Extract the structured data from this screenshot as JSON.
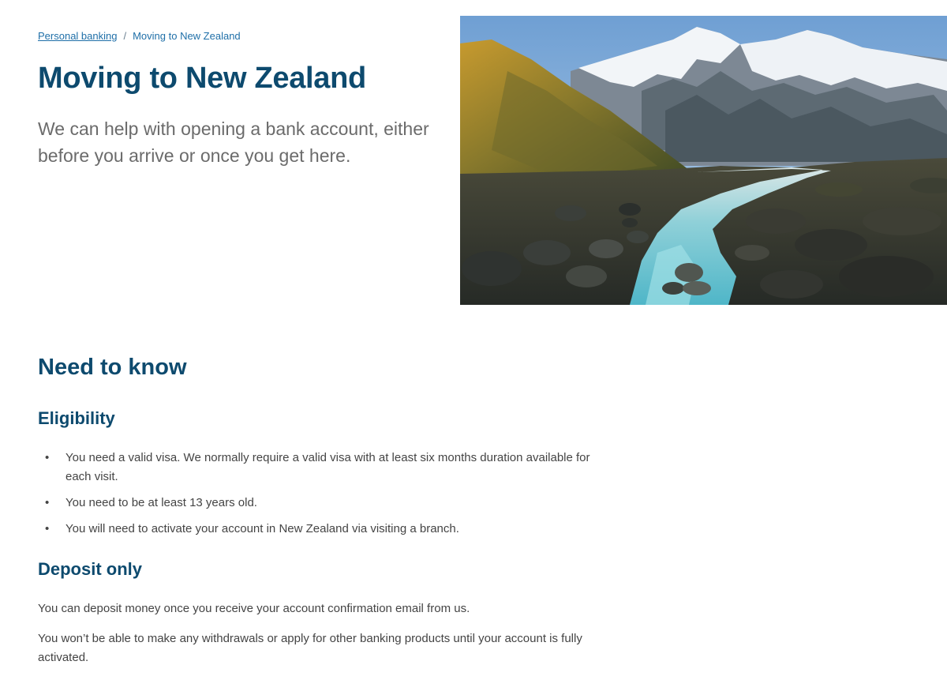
{
  "breadcrumb": {
    "parent": "Personal banking",
    "separator": "/",
    "current": "Moving to New Zealand"
  },
  "hero": {
    "title": "Moving to New Zealand",
    "lead": "We can help with opening a bank account, either before you arrive or once you get here."
  },
  "need_to_know": {
    "title": "Need to know",
    "eligibility": {
      "title": "Eligibility",
      "items": [
        "You need a valid visa. We normally require a valid visa with at least six months duration available for each visit.",
        "You need to be at least 13 years old.",
        "You will need to activate your account in New Zealand via visiting a branch."
      ]
    },
    "deposit": {
      "title": "Deposit only",
      "paragraphs": [
        "You can deposit money once you receive your account confirmation email from us.",
        "You won’t be able to make any withdrawals or apply for other banking products until your account is fully activated."
      ]
    }
  },
  "colors": {
    "heading": "#0d4a6e",
    "link": "#1f6fa8",
    "body_text": "#444444",
    "lead_text": "#6b6b6b"
  }
}
